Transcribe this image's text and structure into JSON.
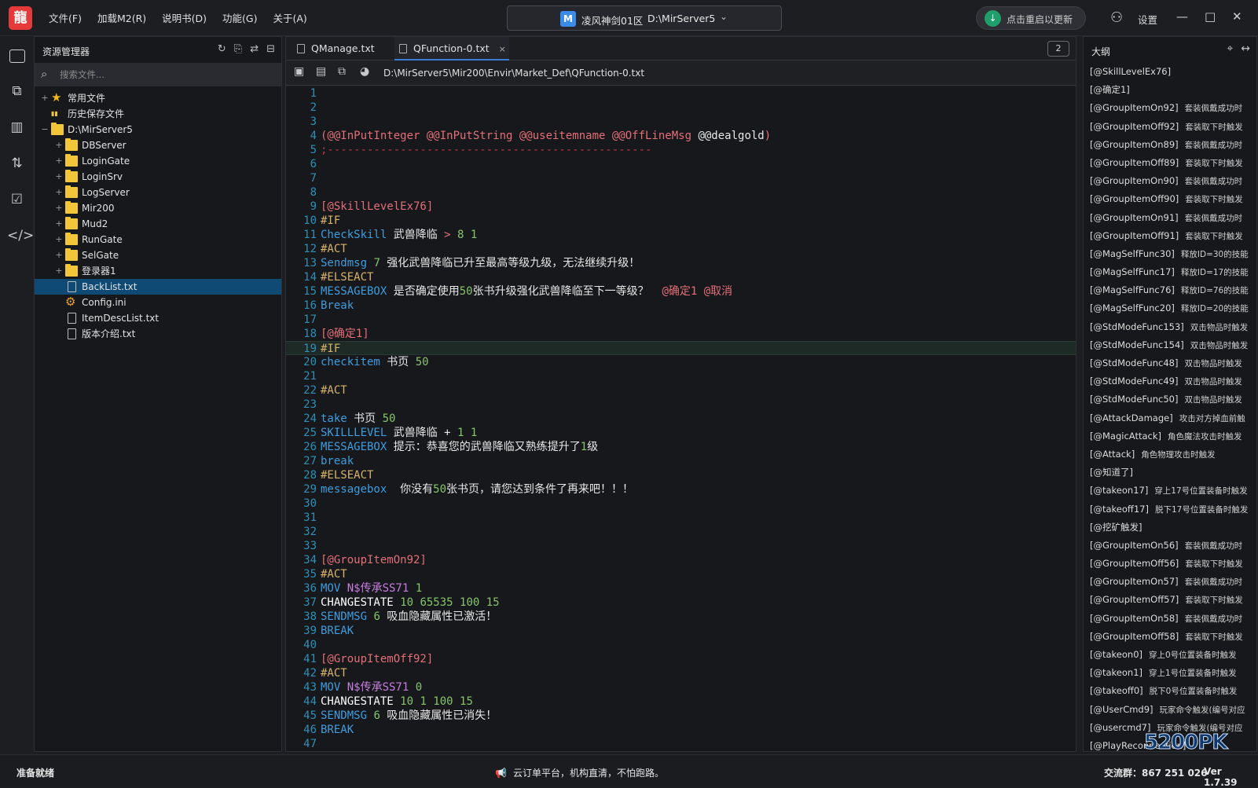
{
  "app": {
    "logo_text": "龍",
    "accent": "#e43a3a"
  },
  "menu": [
    "文件(F)",
    "加载M2(R)",
    "说明书(D)",
    "功能(G)",
    "关于(A)"
  ],
  "server": {
    "badge": "M",
    "name": "凌风神剑01区",
    "path": "D:\\MirServer5"
  },
  "update_label": "点击重启以更新",
  "settings_label": "设置",
  "explorer": {
    "title": "资源管理器",
    "search_placeholder": "搜索文件...",
    "nodes": [
      {
        "label": "常用文件",
        "type": "star",
        "depth": 0,
        "toggle": "+"
      },
      {
        "label": "历史保存文件",
        "type": "book",
        "depth": 0,
        "toggle": ""
      },
      {
        "label": "D:\\MirServer5",
        "type": "folder",
        "depth": 0,
        "toggle": "−"
      },
      {
        "label": "DBServer",
        "type": "folder",
        "depth": 1,
        "toggle": "+"
      },
      {
        "label": "LoginGate",
        "type": "folder",
        "depth": 1,
        "toggle": "+"
      },
      {
        "label": "LoginSrv",
        "type": "folder",
        "depth": 1,
        "toggle": "+"
      },
      {
        "label": "LogServer",
        "type": "folder",
        "depth": 1,
        "toggle": "+"
      },
      {
        "label": "Mir200",
        "type": "folder",
        "depth": 1,
        "toggle": "+"
      },
      {
        "label": "Mud2",
        "type": "folder",
        "depth": 1,
        "toggle": "+"
      },
      {
        "label": "RunGate",
        "type": "folder",
        "depth": 1,
        "toggle": "+"
      },
      {
        "label": "SelGate",
        "type": "folder",
        "depth": 1,
        "toggle": "+"
      },
      {
        "label": "登录器1",
        "type": "folder",
        "depth": 1,
        "toggle": "+"
      },
      {
        "label": "BackList.txt",
        "type": "file",
        "depth": 1,
        "toggle": "",
        "selected": true
      },
      {
        "label": "Config.ini",
        "type": "gear",
        "depth": 1,
        "toggle": ""
      },
      {
        "label": "ItemDescList.txt",
        "type": "file",
        "depth": 1,
        "toggle": ""
      },
      {
        "label": "版本介绍.txt",
        "type": "file",
        "depth": 1,
        "toggle": ""
      }
    ]
  },
  "tabs": [
    {
      "label": "QManage.txt",
      "active": false
    },
    {
      "label": "QFunction-0.txt",
      "active": true
    }
  ],
  "tab_close": "×",
  "tab_count": "2",
  "file_path": "D:\\MirServer5\\Mir200\\Envir\\Market_Def\\QFunction-0.txt",
  "code_lines": [
    [],
    [],
    [],
    [
      [
        "t-lbl",
        "(@@InPutInteger @@InPutString @@useitemname @@OffLineMsg "
      ],
      [
        "t-plain",
        "@@dealgold"
      ],
      [
        "t-lbl",
        ")"
      ]
    ],
    [
      [
        "t-cmt",
        ";-------------------------------------------------"
      ]
    ],
    [],
    [],
    [],
    [
      [
        "t-lbl",
        "[@SkillLevelEx76]"
      ]
    ],
    [
      [
        "t-kw",
        "#IF"
      ]
    ],
    [
      [
        "t-cmd",
        "CheckSkill "
      ],
      [
        "t-plain",
        "武兽降临 "
      ],
      [
        "t-op",
        "> "
      ],
      [
        "t-num",
        "8 1"
      ]
    ],
    [
      [
        "t-kw",
        "#ACT"
      ]
    ],
    [
      [
        "t-cmd",
        "Sendmsg "
      ],
      [
        "t-num",
        "7 "
      ],
      [
        "t-plain",
        "强化武兽降临已升至最高等级九级，无法继续升级！"
      ]
    ],
    [
      [
        "t-kw",
        "#ELSEACT"
      ]
    ],
    [
      [
        "t-cmd",
        "MESSAGEBOX "
      ],
      [
        "t-plain",
        "是否确定使用"
      ],
      [
        "t-num",
        "50"
      ],
      [
        "t-plain",
        "张书升级强化武兽降临至下一等级？  "
      ],
      [
        "t-lbl",
        "@确定1 @取消"
      ]
    ],
    [
      [
        "t-cmd",
        "Break"
      ]
    ],
    [],
    [
      [
        "t-lbl",
        "[@确定1]"
      ]
    ],
    [
      [
        "t-kw",
        "#IF"
      ]
    ],
    [
      [
        "t-cmd",
        "checkitem "
      ],
      [
        "t-plain",
        "书页 "
      ],
      [
        "t-num",
        "50"
      ]
    ],
    [],
    [
      [
        "t-kw",
        "#ACT"
      ]
    ],
    [],
    [
      [
        "t-cmd",
        "take "
      ],
      [
        "t-plain",
        "书页 "
      ],
      [
        "t-num",
        "50"
      ]
    ],
    [
      [
        "t-cmd",
        "SKILLLEVEL "
      ],
      [
        "t-plain",
        "武兽降临 + "
      ],
      [
        "t-num",
        "1 1"
      ]
    ],
    [
      [
        "t-cmd",
        "MESSAGEBOX "
      ],
      [
        "t-plain",
        "提示：恭喜您的武兽降临又熟练提升了"
      ],
      [
        "t-num",
        "1"
      ],
      [
        "t-plain",
        "级"
      ]
    ],
    [
      [
        "t-cmd",
        "break"
      ]
    ],
    [
      [
        "t-kw",
        "#ELSEACT"
      ]
    ],
    [
      [
        "t-cmd",
        "messagebox  "
      ],
      [
        "t-plain",
        "你没有"
      ],
      [
        "t-num",
        "50"
      ],
      [
        "t-plain",
        "张书页，请您达到条件了再来吧！！！"
      ]
    ],
    [],
    [],
    [],
    [],
    [
      [
        "t-lbl",
        "[@GroupItemOn92]"
      ]
    ],
    [
      [
        "t-kw",
        "#ACT"
      ]
    ],
    [
      [
        "t-cmd",
        "MOV "
      ],
      [
        "t-var",
        "N$传承SS71 "
      ],
      [
        "t-num",
        "1"
      ]
    ],
    [
      [
        "t-bold",
        "CHANGESTATE "
      ],
      [
        "t-num",
        "10 65535 100 15"
      ]
    ],
    [
      [
        "t-cmd",
        "SENDMSG "
      ],
      [
        "t-num",
        "6 "
      ],
      [
        "t-plain",
        "吸血隐藏属性已激活！"
      ]
    ],
    [
      [
        "t-cmd",
        "BREAK"
      ]
    ],
    [],
    [
      [
        "t-lbl",
        "[@GroupItemOff92]"
      ]
    ],
    [
      [
        "t-kw",
        "#ACT"
      ]
    ],
    [
      [
        "t-cmd",
        "MOV "
      ],
      [
        "t-var",
        "N$传承SS71 "
      ],
      [
        "t-num",
        "0"
      ]
    ],
    [
      [
        "t-bold",
        "CHANGESTATE "
      ],
      [
        "t-num",
        "10 1 100 15"
      ]
    ],
    [
      [
        "t-cmd",
        "SENDMSG "
      ],
      [
        "t-num",
        "6 "
      ],
      [
        "t-plain",
        "吸血隐藏属性已消失！"
      ]
    ],
    [
      [
        "t-cmd",
        "BREAK"
      ]
    ],
    []
  ],
  "current_line": 19,
  "outline": {
    "title": "大纲",
    "items": [
      {
        "k": "[@SkillLevelEx76]",
        "d": ""
      },
      {
        "k": "[@确定1]",
        "d": ""
      },
      {
        "k": "[@GroupItemOn92]",
        "d": "套装佩戴成功时"
      },
      {
        "k": "[@GroupItemOff92]",
        "d": "套装取下时触发"
      },
      {
        "k": "[@GroupItemOn89]",
        "d": "套装佩戴成功时"
      },
      {
        "k": "[@GroupItemOff89]",
        "d": "套装取下时触发"
      },
      {
        "k": "[@GroupItemOn90]",
        "d": "套装佩戴成功时"
      },
      {
        "k": "[@GroupItemOff90]",
        "d": "套装取下时触发"
      },
      {
        "k": "[@GroupItemOn91]",
        "d": "套装佩戴成功时"
      },
      {
        "k": "[@GroupItemOff91]",
        "d": "套装取下时触发"
      },
      {
        "k": "[@MagSelfFunc30]",
        "d": "释放ID=30的技能"
      },
      {
        "k": "[@MagSelfFunc17]",
        "d": "释放ID=17的技能"
      },
      {
        "k": "[@MagSelfFunc76]",
        "d": "释放ID=76的技能"
      },
      {
        "k": "[@MagSelfFunc20]",
        "d": "释放ID=20的技能"
      },
      {
        "k": "[@StdModeFunc153]",
        "d": "双击物品时触发"
      },
      {
        "k": "[@StdModeFunc154]",
        "d": "双击物品时触发"
      },
      {
        "k": "[@StdModeFunc48]",
        "d": "双击物品时触发"
      },
      {
        "k": "[@StdModeFunc49]",
        "d": "双击物品时触发"
      },
      {
        "k": "[@StdModeFunc50]",
        "d": "双击物品时触发"
      },
      {
        "k": "[@AttackDamage]",
        "d": "攻击对方掉血前触"
      },
      {
        "k": "[@MagicAttack]",
        "d": "角色魔法攻击时触发"
      },
      {
        "k": "[@Attack]",
        "d": "角色物理攻击时触发"
      },
      {
        "k": "[@知道了]",
        "d": ""
      },
      {
        "k": "[@takeon17]",
        "d": "穿上17号位置装备时触发"
      },
      {
        "k": "[@takeoff17]",
        "d": "脱下17号位置装备时触发"
      },
      {
        "k": "[@挖矿触发]",
        "d": ""
      },
      {
        "k": "[@GroupItemOn56]",
        "d": "套装佩戴成功时"
      },
      {
        "k": "[@GroupItemOff56]",
        "d": "套装取下时触发"
      },
      {
        "k": "[@GroupItemOn57]",
        "d": "套装佩戴成功时"
      },
      {
        "k": "[@GroupItemOff57]",
        "d": "套装取下时触发"
      },
      {
        "k": "[@GroupItemOn58]",
        "d": "套装佩戴成功时"
      },
      {
        "k": "[@GroupItemOff58]",
        "d": "套装取下时触发"
      },
      {
        "k": "[@takeon0]",
        "d": "穿上0号位置装备时触发"
      },
      {
        "k": "[@takeon1]",
        "d": "穿上1号位置装备时触发"
      },
      {
        "k": "[@takeoff0]",
        "d": "脱下0号位置装备时触发"
      },
      {
        "k": "[@UserCmd9]",
        "d": "玩家命令触发(编号对应"
      },
      {
        "k": "[@usercmd7]",
        "d": "玩家命令触发(编号对应"
      },
      {
        "k": "[@PlayReconnection]",
        "d": ""
      }
    ]
  },
  "status": {
    "left": "准备就绪",
    "center": "云订单平台，机构直清，不怕跑路。",
    "right": "交流群：867 251 026",
    "version": "Ver 1.7.39"
  },
  "watermark": "5200PK"
}
